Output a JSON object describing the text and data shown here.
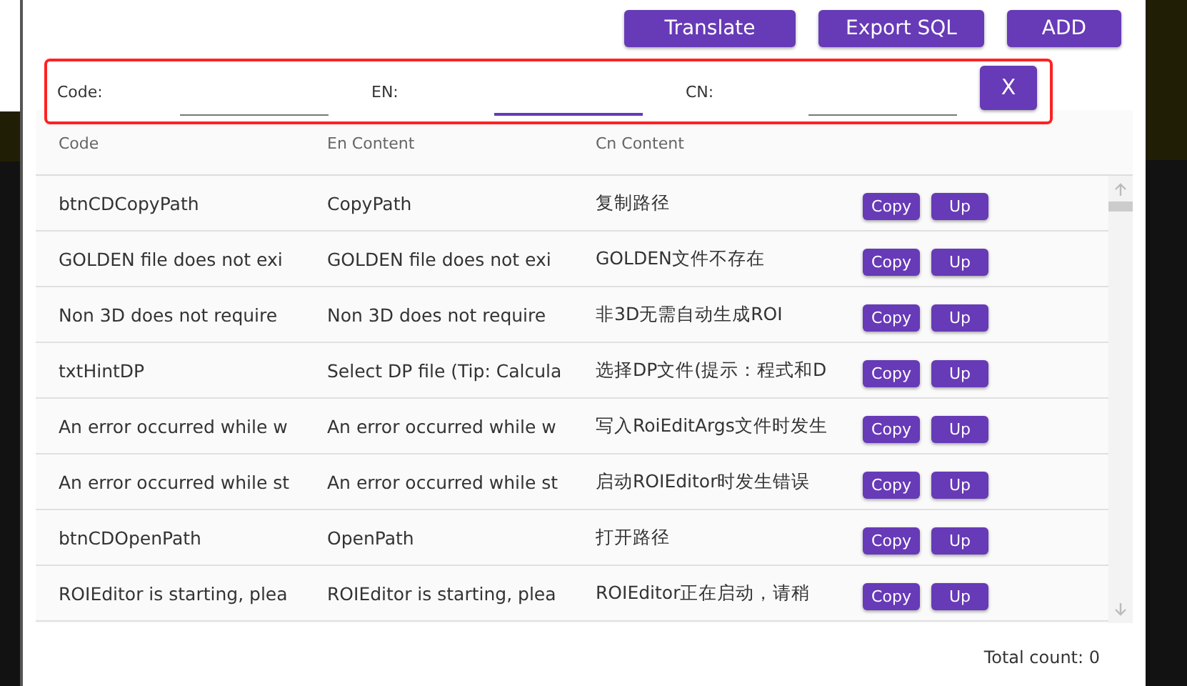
{
  "toolbar": {
    "buttons": [
      "Translate",
      "Export SQL",
      "ADD"
    ]
  },
  "filter": {
    "fields": [
      {
        "label": "Code:",
        "focused": false
      },
      {
        "label": "EN:",
        "focused": true
      },
      {
        "label": "CN:",
        "focused": false
      }
    ],
    "clear_button": "X"
  },
  "table": {
    "columns": [
      "Code",
      "En Content",
      "Cn Content"
    ],
    "rows": [
      {
        "code": "btnCDCopyPath",
        "en": "CopyPath",
        "cn": "复制路径",
        "actions": [
          "Copy",
          "Up"
        ]
      },
      {
        "code": "GOLDEN file does not exi",
        "en": "GOLDEN file does not exi",
        "cn": "GOLDEN文件不存在",
        "actions": [
          "Copy",
          "Up"
        ]
      },
      {
        "code": "Non 3D does not require",
        "en": "Non 3D does not require",
        "cn": "非3D无需自动生成ROI",
        "actions": [
          "Copy",
          "Up"
        ]
      },
      {
        "code": "txtHintDP",
        "en": "Select DP file (Tip: Calcula",
        "cn": "选择DP文件(提示：程式和D",
        "actions": [
          "Copy",
          "Up"
        ]
      },
      {
        "code": "An error occurred while w",
        "en": "An error occurred while w",
        "cn": "写入RoiEditArgs文件时发生",
        "actions": [
          "Copy",
          "Up"
        ]
      },
      {
        "code": "An error occurred while st",
        "en": "An error occurred while st",
        "cn": "启动ROIEditor时发生错误",
        "actions": [
          "Copy",
          "Up"
        ]
      },
      {
        "code": "btnCDOpenPath",
        "en": "OpenPath",
        "cn": "打开路径",
        "actions": [
          "Copy",
          "Up"
        ]
      },
      {
        "code": "ROIEditor is starting, plea",
        "en": "ROIEditor is starting, plea",
        "cn": "ROIEditor正在启动，请稍",
        "actions": [
          "Copy",
          "Up"
        ]
      }
    ]
  },
  "footer": {
    "total": "Total count: 0"
  }
}
